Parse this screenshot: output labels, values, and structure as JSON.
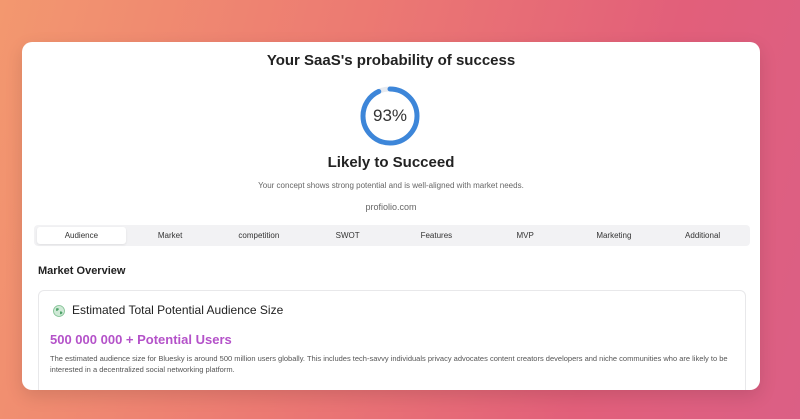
{
  "card": {
    "title": "Your SaaS's probability of success",
    "gauge": {
      "value": 93,
      "label": "93%",
      "color": "#3d86d9"
    },
    "status": "Likely to Succeed",
    "description": "Your concept shows strong potential and is well-aligned with market needs.",
    "brand": "profiolio.com"
  },
  "tabs": [
    {
      "label": "Audience",
      "active": true
    },
    {
      "label": "Market"
    },
    {
      "label": "competition"
    },
    {
      "label": "SWOT"
    },
    {
      "label": "Features"
    },
    {
      "label": "MVP"
    },
    {
      "label": "Marketing"
    },
    {
      "label": "Additional"
    }
  ],
  "section": {
    "title": "Market Overview",
    "panel": {
      "icon": "globe-icon",
      "heading": "Estimated Total Potential Audience Size",
      "highlight": "500 000 000 + Potential Users",
      "highlight_color": "#b452c9",
      "body": "The estimated audience size for Bluesky is around 500 million users globally. This includes tech-savvy individuals privacy advocates content creators developers and niche communities who are likely to be interested in a decentralized social networking platform."
    }
  }
}
